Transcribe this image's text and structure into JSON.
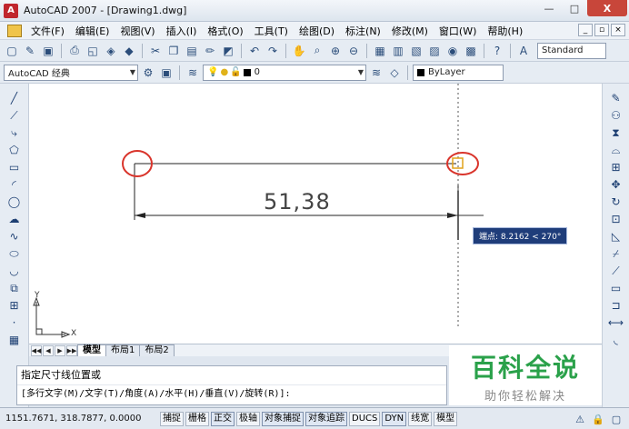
{
  "window": {
    "title": "AutoCAD 2007 - [Drawing1.dwg]",
    "app_icon": "A",
    "controls": [
      "—",
      "□",
      "X"
    ]
  },
  "menubar": {
    "items": [
      "文件(F)",
      "编辑(E)",
      "视图(V)",
      "插入(I)",
      "格式(O)",
      "工具(T)",
      "绘图(D)",
      "标注(N)",
      "修改(M)",
      "窗口(W)",
      "帮助(H)"
    ],
    "doc_controls": [
      "_",
      "▫",
      "×"
    ]
  },
  "toolbar1": {
    "text_style": "Standard"
  },
  "toolbar2": {
    "workspace": "AutoCAD 经典",
    "layer": "0",
    "linetype": "ByLayer"
  },
  "canvas": {
    "dimension_value": "51,38",
    "tooltip": "端点: 8.2162 < 270°",
    "ucs_y": "Y",
    "ucs_x": "X",
    "colors": {
      "circle": "#d9342b",
      "line": "#222222",
      "marker": "#e0a21a",
      "tooltip_bg": "#1f3d7a"
    }
  },
  "tabs": {
    "nav": [
      "◀◀",
      "◀",
      "▶",
      "▶▶"
    ],
    "items": [
      "模型",
      "布局1",
      "布局2"
    ],
    "active": "模型"
  },
  "command": {
    "line1": "指定尺寸线位置或",
    "line2": "[多行文字(M)/文字(T)/角度(A)/水平(H)/垂直(V)/旋转(R)]:"
  },
  "watermark": {
    "main": "百科全说",
    "sub": "助你轻松解决"
  },
  "statusbar": {
    "coordinates": "1151.7671, 318.7877, 0.0000",
    "buttons": [
      "捕捉",
      "栅格",
      "正交",
      "极轴",
      "对象捕捉",
      "对象追踪",
      "DUCS",
      "DYN",
      "线宽",
      "模型"
    ]
  }
}
